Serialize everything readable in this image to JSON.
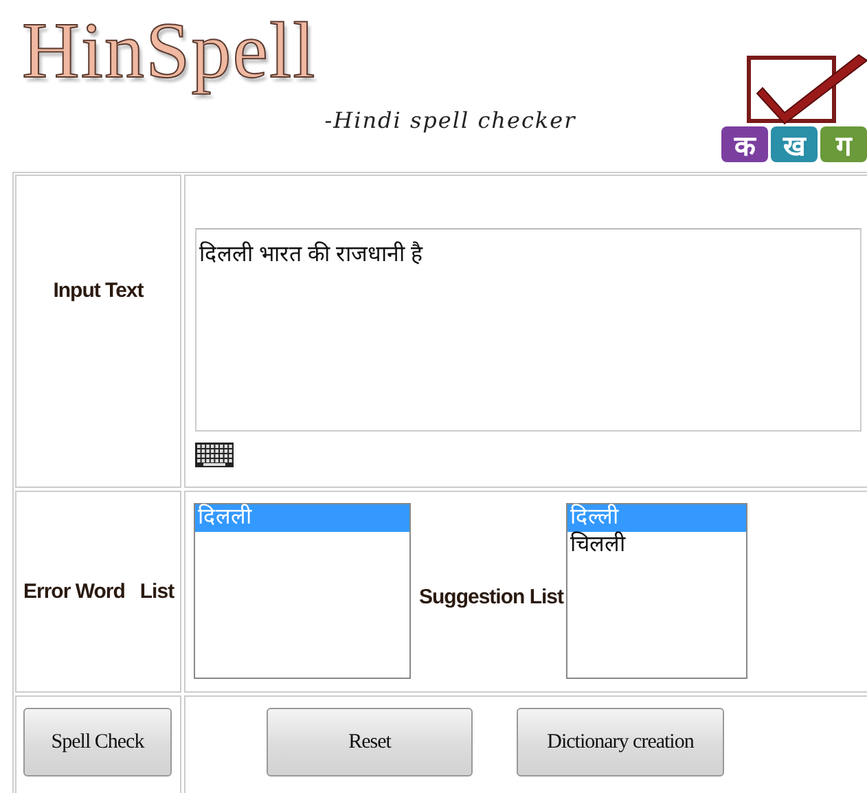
{
  "header": {
    "logo": "HinSpell",
    "tagline": "-Hindi spell checker",
    "badge_letters": [
      {
        "text": "क",
        "color": "#7b3fa0"
      },
      {
        "text": "ख",
        "color": "#2a8fa8"
      },
      {
        "text": "ग",
        "color": "#6a9a3a"
      }
    ]
  },
  "input_row": {
    "label": "Input Text",
    "value": "दिलली भारत की राजधानी है"
  },
  "lists_row": {
    "label": "Error Word   List",
    "error_words": [
      {
        "text": "दिलली",
        "selected": true
      }
    ],
    "suggestion_label": "Suggestion List",
    "suggestions": [
      {
        "text": "दिल्ली",
        "selected": true
      },
      {
        "text": "चिलली",
        "selected": false
      }
    ]
  },
  "buttons_row": {
    "left_button": "Spell Check",
    "buttons": [
      "Reset",
      "Dictionary creation"
    ]
  }
}
